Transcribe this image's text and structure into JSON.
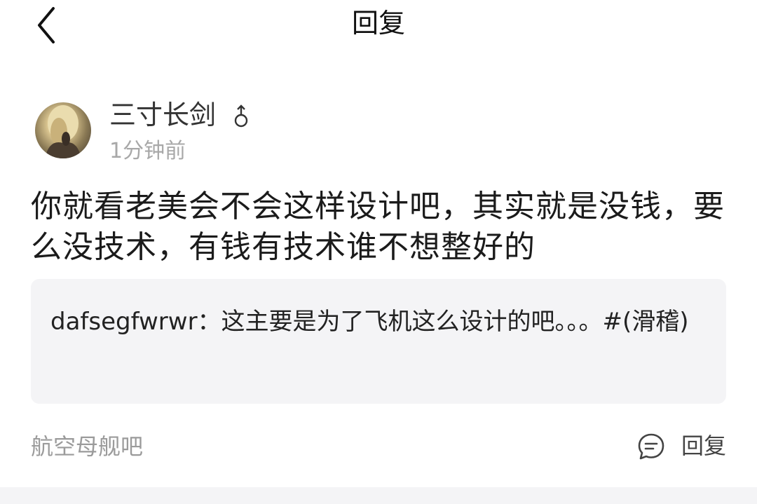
{
  "header": {
    "title": "回复",
    "back_icon": "chevron-left-icon"
  },
  "author": {
    "name": "三寸长剑",
    "gender_icon": "male-symbol-icon",
    "gender_symbol": "♂",
    "time": "1分钟前"
  },
  "reply": {
    "text": "你就看老美会不会这样设计吧，其实就是没钱，要么没技术，有钱有技术谁不想整好的"
  },
  "quote": {
    "text": "dafsegfwrwr：这主要是为了飞机这么设计的吧。。。#(滑稽)"
  },
  "footer": {
    "forum": "航空母舰吧",
    "reply_label": "回复",
    "reply_icon": "comment-icon"
  },
  "colors": {
    "background": "#ffffff",
    "quote_background": "#f4f4f6",
    "secondary_text": "#9b9b9b"
  }
}
